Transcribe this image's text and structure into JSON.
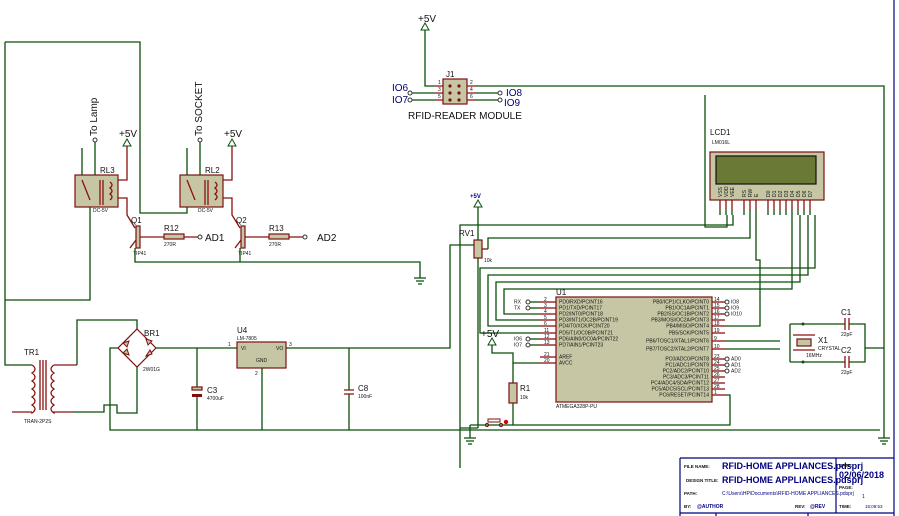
{
  "power": {
    "vcc": "+5V"
  },
  "rfid": {
    "ref": "J1",
    "name": "RFID-READER MODULE",
    "pins": [
      "1",
      "2",
      "3",
      "4",
      "5",
      "6"
    ],
    "io_left": [
      "IO6",
      "IO7"
    ],
    "io_right": [
      "IO8",
      "IO9"
    ]
  },
  "relays": [
    {
      "ref": "RL3",
      "value": "DC-5V",
      "target": "To  Lamp"
    },
    {
      "ref": "RL2",
      "value": "DC-5V",
      "target": "To SOCKET"
    }
  ],
  "transistors": [
    {
      "ref": "Q1",
      "value": "TIP41",
      "resistor": "R12",
      "resistor_value": "270R",
      "input": "AD1"
    },
    {
      "ref": "Q2",
      "value": "TIP41",
      "resistor": "R13",
      "resistor_value": "270R",
      "input": "AD2"
    }
  ],
  "lcd": {
    "ref": "LCD1",
    "value": "LM016L",
    "pins": [
      "VSS",
      "VDD",
      "VEE",
      "RS",
      "RW",
      "E",
      "D0",
      "D1",
      "D2",
      "D3",
      "D4",
      "D5",
      "D6",
      "D7"
    ]
  },
  "rv1": {
    "ref": "RV1",
    "value": "10k"
  },
  "mcu": {
    "ref": "U1",
    "value": "ATMEGA328P-PU",
    "left_pins": [
      {
        "num": "2",
        "name": "PD0/RXD/PCINT16",
        "net": "RX"
      },
      {
        "num": "3",
        "name": "PD1/TXD/PCINT17",
        "net": "TX"
      },
      {
        "num": "4",
        "name": "PD2/INT0/PCINT18",
        "net": ""
      },
      {
        "num": "5",
        "name": "PD3/INT1/OC2B/PCINT19",
        "net": ""
      },
      {
        "num": "6",
        "name": "PD4/T0/XCK/PCINT20",
        "net": ""
      },
      {
        "num": "11",
        "name": "PD5/T1/OC0B/PCINT21",
        "net": ""
      },
      {
        "num": "12",
        "name": "PD6/AIN0/OC0A/PCINT22",
        "net": "IO6"
      },
      {
        "num": "13",
        "name": "PD7/AIN1/PCINT23",
        "net": "IO7"
      },
      {
        "num": "21",
        "name": "AREF",
        "net": ""
      },
      {
        "num": "20",
        "name": "AVCC",
        "net": ""
      }
    ],
    "right_pins": [
      {
        "num": "14",
        "name": "PB0/ICP1/CLKO/PCINT0",
        "net": "IO8"
      },
      {
        "num": "15",
        "name": "PB1/OC1A/PCINT1",
        "net": "IO9"
      },
      {
        "num": "16",
        "name": "PB2/SS/OC1B/PCINT2",
        "net": "IO10"
      },
      {
        "num": "17",
        "name": "PB3/MOSI/OC2A/PCINT3",
        "net": ""
      },
      {
        "num": "18",
        "name": "PB4/MISO/PCINT4",
        "net": ""
      },
      {
        "num": "19",
        "name": "PB5/SCK/PCINT5",
        "net": ""
      },
      {
        "num": "9",
        "name": "PB6/TOSC1/XTAL1/PCINT6",
        "net": ""
      },
      {
        "num": "10",
        "name": "PB7/TOSC2/XTAL2/PCINT7",
        "net": ""
      },
      {
        "num": "23",
        "name": "PC0/ADC0/PCINT8",
        "net": "AD0"
      },
      {
        "num": "24",
        "name": "PC1/ADC1/PCINT9",
        "net": "AD1"
      },
      {
        "num": "25",
        "name": "PC2/ADC2/PCINT10",
        "net": "AD2"
      },
      {
        "num": "26",
        "name": "PC3/ADC3/PCINT11",
        "net": ""
      },
      {
        "num": "27",
        "name": "PC4/ADC4/SDA/PCINT12",
        "net": ""
      },
      {
        "num": "28",
        "name": "PC5/ADC5/SCL/PCINT13",
        "net": ""
      },
      {
        "num": "1",
        "name": "PC6/RESET/PCINT14",
        "net": ""
      }
    ]
  },
  "r1": {
    "ref": "R1",
    "value": "10k"
  },
  "crystal": {
    "ref": "X1",
    "value": "CRYSTAL",
    "freq": "16MHz",
    "c1": "C1",
    "c1_value": "22pF",
    "c2": "C2",
    "c2_value": "22pF"
  },
  "supply": {
    "tr1": {
      "ref": "TR1",
      "value": "TRAN-2P2S"
    },
    "br1": {
      "ref": "BR1",
      "value": "2W01G"
    },
    "u4": {
      "ref": "U4",
      "value": "LM-7805",
      "vi": "VI",
      "vo": "VO",
      "gnd": "GND",
      "pin1": "1",
      "pin2": "2",
      "pin3": "3"
    },
    "c3": {
      "ref": "C3",
      "value": "4700uF"
    },
    "c8": {
      "ref": "C8",
      "value": "100nF"
    }
  },
  "title_block": {
    "file_name_label": "FILE NAME:",
    "file_name": "RFID-HOME APPLIANCES.pdsprj",
    "design_title_label": "DESIGN TITLE:",
    "design_title": "RFID-HOME APPLIANCES.pdsprj",
    "path_label": "PATH:",
    "path": "C:\\Users\\HP\\Documents\\RFID-HOME APPLIANCES.pdsprj",
    "by_label": "BY:",
    "by": "@AUTHOR",
    "rev_label": "REV:",
    "rev": "@REV",
    "date_label": "DATE:",
    "date": "02/06/2018",
    "page_label": "PAGE:",
    "page": "1",
    "time_label": "TIME:",
    "time": "15:09:53"
  }
}
